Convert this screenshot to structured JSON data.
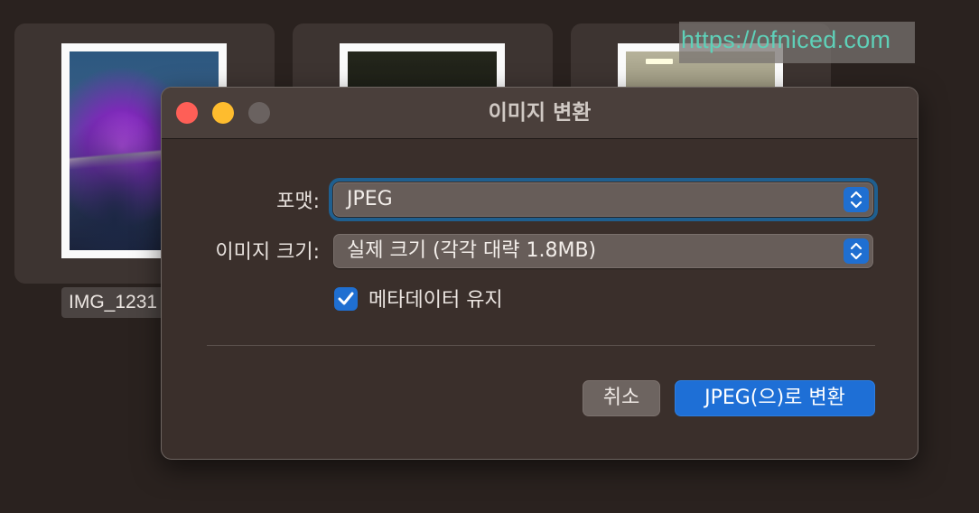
{
  "watermark": {
    "text": "https://ofniced.com"
  },
  "files": [
    {
      "label": "IMG_1231"
    }
  ],
  "dialog": {
    "title": "이미지 변환",
    "format": {
      "label": "포맷:",
      "value": "JPEG"
    },
    "image_size": {
      "label": "이미지 크기:",
      "value": "실제 크기 (각각 대략 1.8MB)"
    },
    "keep_metadata": {
      "label": "메타데이터 유지",
      "checked": true
    },
    "cancel_label": "취소",
    "convert_label": "JPEG(으)로 변환"
  },
  "colors": {
    "accent": "#1e6fd6",
    "close": "#fe5f57",
    "minimize": "#febc2e",
    "window_bg": "#3a2f2b"
  }
}
